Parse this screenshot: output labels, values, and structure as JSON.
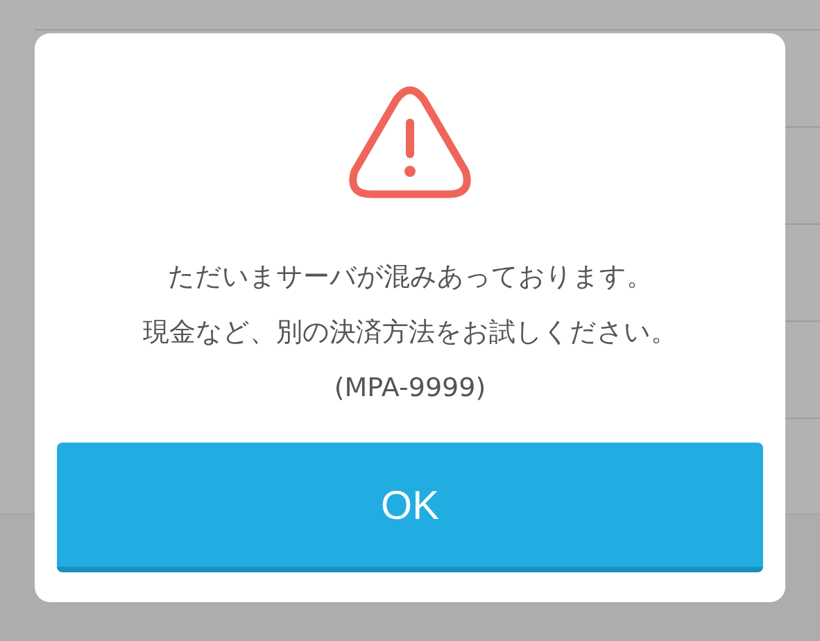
{
  "dialog": {
    "message_lines": [
      "ただいまサーバが混みあっております。",
      "現金など、別の決済方法をお試しください。",
      "(MPA-9999)"
    ],
    "button": {
      "label": "OK"
    }
  }
}
